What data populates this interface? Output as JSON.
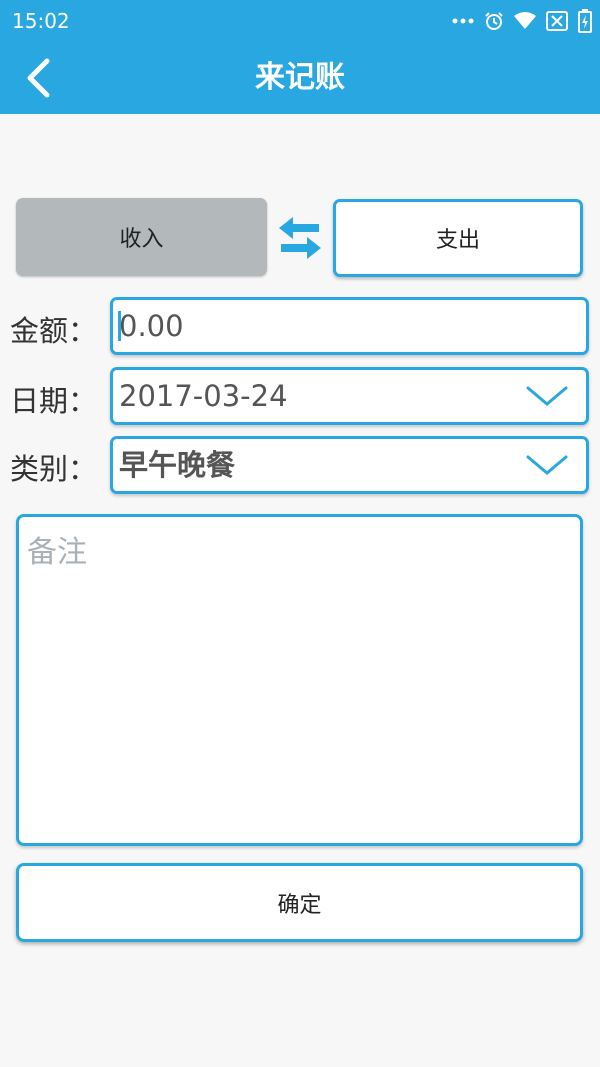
{
  "status_bar": {
    "time": "15:02",
    "icons": [
      "more-dots-icon",
      "alarm-icon",
      "wifi-icon",
      "no-sim-icon",
      "battery-charging-icon"
    ]
  },
  "app_bar": {
    "title": "来记账",
    "back_icon": "chevron-left-icon"
  },
  "type_toggle": {
    "income_label": "收入",
    "expense_label": "支出",
    "selected": "收入",
    "swap_icon": "swap-arrows-icon"
  },
  "form": {
    "amount_label": "金额：",
    "amount_value": "0.00",
    "date_label": "日期：",
    "date_value": "2017-03-24",
    "category_label": "类别：",
    "category_value": "早午晚餐",
    "note_placeholder": "备注"
  },
  "confirm_label": "确定",
  "colors": {
    "primary": "#29a7e1",
    "selected_toggle": "#b3b8bb",
    "background": "#f7f7f7",
    "placeholder": "#aab1b6"
  }
}
